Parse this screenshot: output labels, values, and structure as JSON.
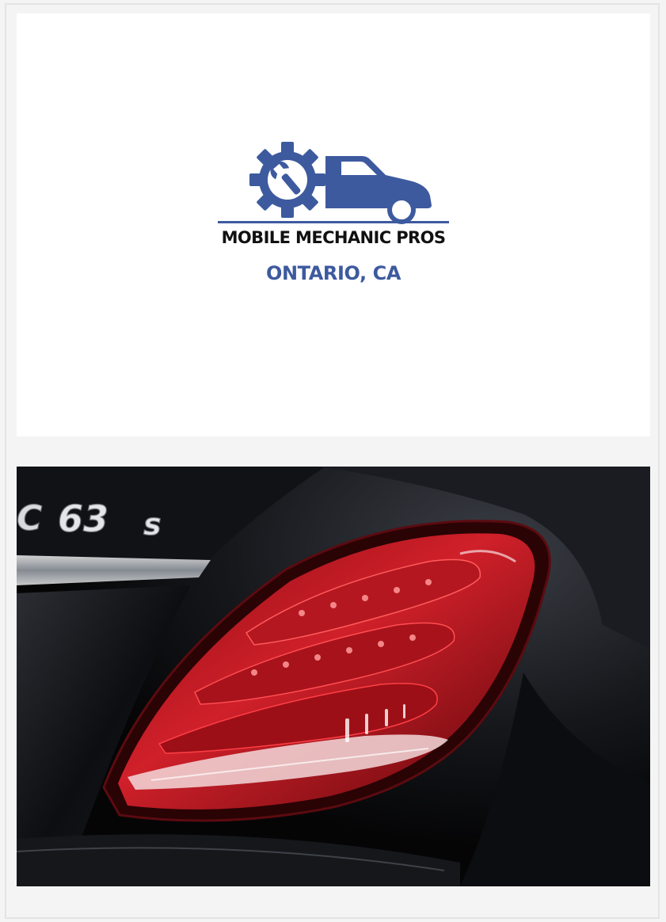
{
  "logo": {
    "brand_name": "MOBILE MECHANIC PROS",
    "location": "ONTARIO, CA",
    "icons": [
      "gear-wrench-icon",
      "car-icon"
    ],
    "colors": {
      "brand_blue": "#3d5a9f",
      "text_dark": "#111111"
    }
  },
  "photo": {
    "subject": "car taillight",
    "badge_text": "C 63s"
  }
}
